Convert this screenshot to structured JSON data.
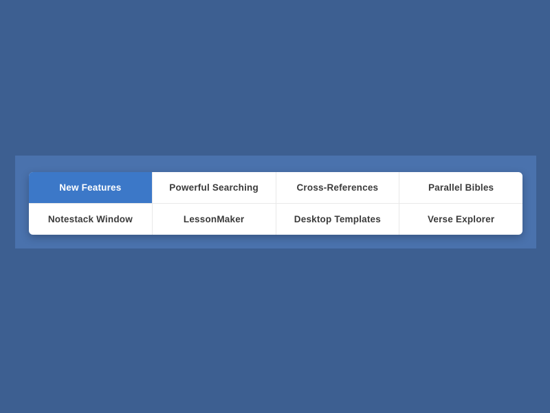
{
  "tabs": {
    "row1": [
      {
        "label": "New Features",
        "active": true
      },
      {
        "label": "Powerful Searching",
        "active": false
      },
      {
        "label": "Cross-References",
        "active": false
      },
      {
        "label": "Parallel Bibles",
        "active": false
      }
    ],
    "row2": [
      {
        "label": "Notestack Window",
        "active": false
      },
      {
        "label": "LessonMaker",
        "active": false
      },
      {
        "label": "Desktop Templates",
        "active": false
      },
      {
        "label": "Verse Explorer",
        "active": false
      }
    ]
  }
}
